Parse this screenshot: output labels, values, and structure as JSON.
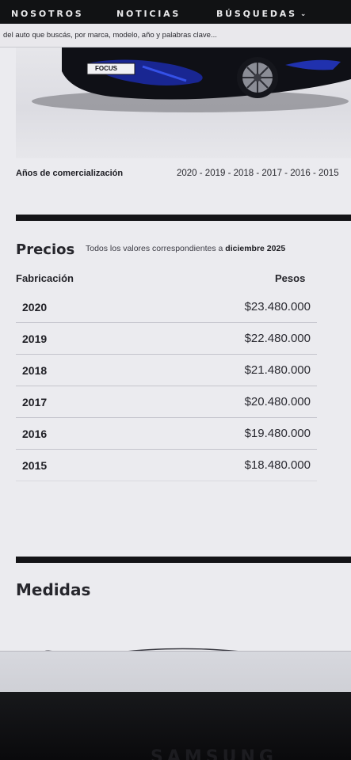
{
  "nav": {
    "items": [
      "NOSOTROS",
      "NOTICIAS",
      "BÚSQUEDAS"
    ]
  },
  "search": {
    "placeholder": "del auto que buscás, por marca, modelo, año y palabras clave..."
  },
  "car": {
    "badge": "FOCUS"
  },
  "years": {
    "label": "Años de comercialización",
    "values": "2020 - 2019 - 2018 - 2017 - 2016 - 2015"
  },
  "prices": {
    "title": "Precios",
    "note_prefix": "Todos los valores correspondientes a",
    "note_date": "diciembre 2025",
    "col_left": "Fabricación",
    "col_right": "Pesos",
    "rows": [
      {
        "year": "2020",
        "amount": "$23.480.000"
      },
      {
        "year": "2019",
        "amount": "$22.480.000"
      },
      {
        "year": "2018",
        "amount": "$21.480.000"
      },
      {
        "year": "2017",
        "amount": "$20.480.000"
      },
      {
        "year": "2016",
        "amount": "$19.480.000"
      },
      {
        "year": "2015",
        "amount": "$18.480.000"
      }
    ]
  },
  "medidas": {
    "title": "Medidas"
  },
  "brand": "SAMSUNG"
}
